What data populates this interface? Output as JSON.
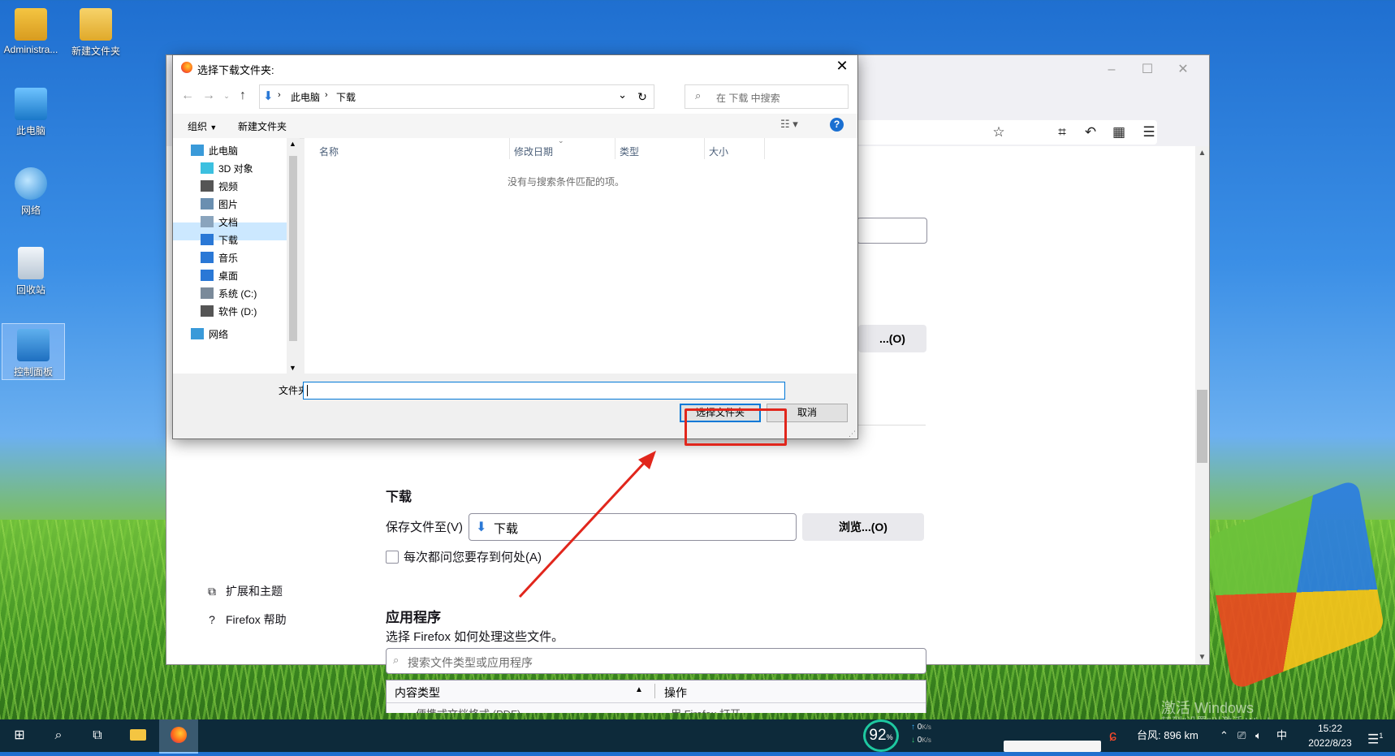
{
  "desktop": {
    "icons": [
      {
        "label": "Administra..."
      },
      {
        "label": "新建文件夹"
      },
      {
        "label": "此电脑"
      },
      {
        "label": "网络"
      },
      {
        "label": "回收站"
      },
      {
        "label": "控制面板"
      }
    ]
  },
  "firefox": {
    "browse_label": "浏览...(O)",
    "browse_partial": "...(O)",
    "download_heading_partial": "下载",
    "save_to_label": "保存文件至(V)",
    "save_to_value": "下载",
    "always_ask_label": "每次都问您要存到何处(A)",
    "always_ask_checked": false,
    "apps_heading": "应用程序",
    "apps_desc": "选择 Firefox 如何处理这些文件。",
    "apps_search_placeholder": "搜索文件类型或应用程序",
    "table_col_content_type": "内容类型",
    "table_col_action": "操作",
    "table_row_partial_type": "便携式文档格式 (PDF)",
    "table_row_partial_action": "用 Firefox 打开",
    "sidebar": [
      {
        "label": "扩展和主题"
      },
      {
        "label": "Firefox 帮助"
      }
    ]
  },
  "dialog": {
    "title": "选择下载文件夹:",
    "address": {
      "root": "此电脑",
      "current": "下载"
    },
    "search_placeholder": "在 下载 中搜索",
    "toolbar": {
      "organize": "组织",
      "new_folder": "新建文件夹"
    },
    "tree": [
      {
        "label": "此电脑",
        "color": "#3a9ad9"
      },
      {
        "label": "3D 对象",
        "color": "#3cc0e0"
      },
      {
        "label": "视频",
        "color": "#555555"
      },
      {
        "label": "图片",
        "color": "#6a8fb0"
      },
      {
        "label": "文档",
        "color": "#8aa4bd"
      },
      {
        "label": "下载",
        "color": "#2a78d6"
      },
      {
        "label": "音乐",
        "color": "#2a78d6"
      },
      {
        "label": "桌面",
        "color": "#2a78d6"
      },
      {
        "label": "系统 (C:)",
        "color": "#7a8a9a"
      },
      {
        "label": "软件 (D:)",
        "color": "#555555"
      },
      {
        "label": "网络",
        "color": "#3a9ad9"
      }
    ],
    "selected_tree_item": "下载",
    "columns": [
      "名称",
      "修改日期",
      "类型",
      "大小"
    ],
    "empty_message": "没有与搜索条件匹配的项。",
    "folder_label": "文件夹:",
    "folder_value": "",
    "select_button": "选择文件夹",
    "cancel_button": "取消"
  },
  "taskbar": {
    "cpu_percent": "92",
    "net_up": "0",
    "net_down": "0",
    "net_unit": "K/s",
    "weather": "台风: 896 km",
    "ime": "中",
    "time": "15:22",
    "date": "2022/8/23",
    "notification_count": "1"
  },
  "watermark": {
    "line1": "激活 Windows",
    "line2": "转到\"设置\"以激活 Windows。"
  },
  "colors": {
    "highlight_red": "#e1261c",
    "accent_blue": "#0078d7",
    "selection_bg": "#cce8ff"
  }
}
